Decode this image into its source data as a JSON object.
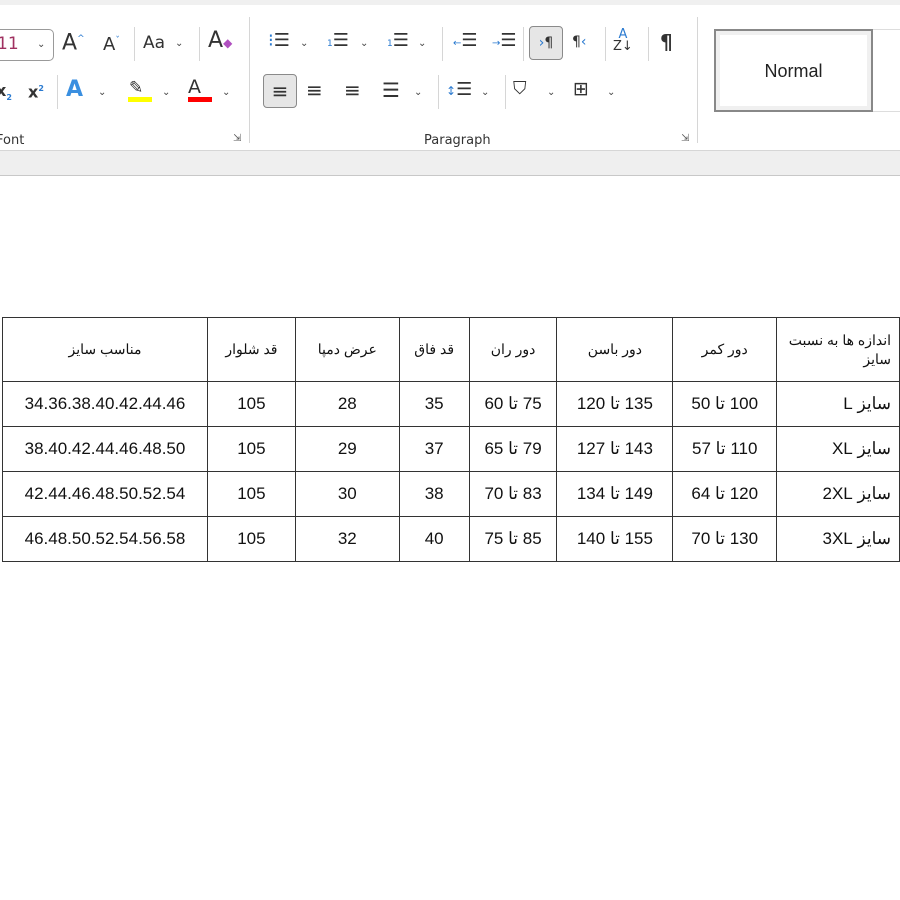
{
  "ribbon": {
    "font_size_value": "11",
    "font_group_label": "Font",
    "paragraph_group_label": "Paragraph",
    "style_normal": "Normal",
    "highlight_color": "#ffff00",
    "font_color": "#ff0000"
  },
  "table": {
    "headers": [
      "اندازه ها به نسبت سایز",
      "دور کمر",
      "دور باسن",
      "دور ران",
      "قد فاق",
      "عرض دمپا",
      "قد شلوار",
      "مناسب سایز"
    ],
    "rows": [
      [
        "سایز L",
        "100 تا 50",
        "135 تا 120",
        "75 تا 60",
        "35",
        "28",
        "105",
        "34.36.38.40.42.44.46"
      ],
      [
        "سایز XL",
        "110 تا 57",
        "143 تا 127",
        "79 تا 65",
        "37",
        "29",
        "105",
        "38.40.42.44.46.48.50"
      ],
      [
        "سایز 2XL",
        "120 تا 64",
        "149 تا 134",
        "83 تا 70",
        "38",
        "30",
        "105",
        "42.44.46.48.50.52.54"
      ],
      [
        "سایز 3XL",
        "130 تا 70",
        "155 تا 140",
        "85 تا 75",
        "40",
        "32",
        "105",
        "46.48.50.52.54.56.58"
      ]
    ]
  }
}
